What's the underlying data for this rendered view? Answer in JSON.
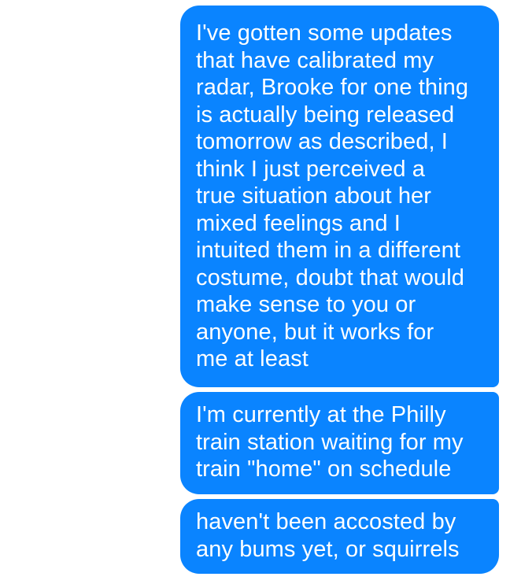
{
  "messages": [
    {
      "text": "I've gotten some updates\nthat have calibrated my\nradar, Brooke for one thing\nis actually being released\ntomorrow as described, I\nthink I just perceived a\ntrue situation about her\nmixed feelings and I\nintuited them in a different\ncostume, doubt that would\nmake sense to you or\nanyone, but it works for\nme at least"
    },
    {
      "text": "I'm currently at the Philly\ntrain station waiting for my\ntrain \"home\" on schedule"
    },
    {
      "text": "haven't been accosted by\nany bums yet, or squirrels"
    }
  ],
  "colors": {
    "bubble_bg": "#0a84ff",
    "bubble_text": "#ffffff",
    "background": "#ffffff"
  }
}
